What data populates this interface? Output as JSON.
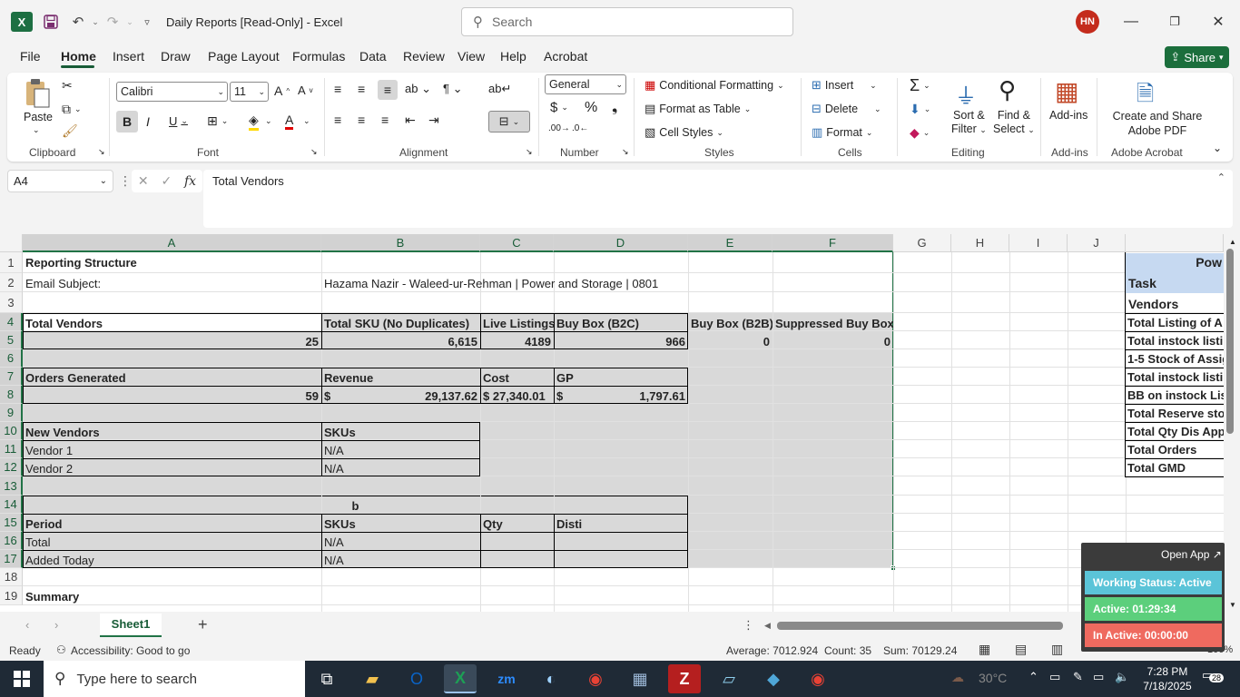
{
  "window": {
    "title": "Daily Reports  [Read-Only]  -  Excel",
    "search_placeholder": "Search",
    "user_initials": "HN"
  },
  "tabs": [
    "File",
    "Home",
    "Insert",
    "Draw",
    "Page Layout",
    "Formulas",
    "Data",
    "Review",
    "View",
    "Help",
    "Acrobat"
  ],
  "share_label": "Share",
  "ribbon": {
    "clipboard": {
      "paste": "Paste",
      "label": "Clipboard"
    },
    "font": {
      "name": "Calibri",
      "size": "11",
      "label": "Font"
    },
    "alignment": {
      "label": "Alignment"
    },
    "number": {
      "format": "General",
      "label": "Number"
    },
    "styles": {
      "conditional": "Conditional Formatting",
      "table": "Format as Table",
      "cell": "Cell Styles",
      "label": "Styles"
    },
    "cells": {
      "insert": "Insert",
      "delete": "Delete",
      "format": "Format",
      "label": "Cells"
    },
    "editing": {
      "sort": "Sort &",
      "filter": "Filter",
      "find": "Find &",
      "select": "Select",
      "label": "Editing"
    },
    "addins": {
      "addins": "Add-ins",
      "label": "Add-ins"
    },
    "acrobat": {
      "line1": "Create and Share",
      "line2": "Adobe PDF",
      "label": "Adobe Acrobat"
    }
  },
  "formula_bar": {
    "name_box": "A4",
    "content": "Total Vendors"
  },
  "columns": [
    "A",
    "B",
    "C",
    "D",
    "E",
    "F",
    "G",
    "H",
    "I",
    "J"
  ],
  "rows": [
    "1",
    "2",
    "3",
    "4",
    "5",
    "6",
    "7",
    "8",
    "9",
    "10",
    "11",
    "12",
    "13",
    "14",
    "15",
    "16",
    "17",
    "18",
    "19"
  ],
  "cells": {
    "A1": "Reporting Structure",
    "A2": "Email Subject:",
    "B2": "Hazama Nazir - Waleed-ur-Rehman | Power and Storage | 0801",
    "A4": "Total Vendors",
    "B4": "Total SKU (No Duplicates)",
    "C4": "Live Listings",
    "D4": "Buy Box (B2C)",
    "E4": "Buy Box (B2B)",
    "F4": "Suppressed Buy Box",
    "A5": "25",
    "B5": "6,615",
    "C5": "4189",
    "D5": "966",
    "E5": "0",
    "F5": "0",
    "A7": "Orders Generated",
    "B7": "Revenue",
    "C7": "Cost",
    "D7": "GP",
    "A8": "59",
    "B8_sym": "$",
    "B8": "29,137.62",
    "C8": "$ 27,340.01",
    "D8_sym": "$",
    "D8": "1,797.61",
    "A10": "New Vendors",
    "B10": "SKUs",
    "A11": "Vendor 1",
    "B11": "N/A",
    "A12": "Vendor 2",
    "B12": "N/A",
    "B14": "b",
    "A15": "Period",
    "B15": "SKUs",
    "C15": "Qty",
    "D15": "Disti",
    "A16": "Total",
    "B16": "N/A",
    "A17": "Added Today",
    "B17": "N/A",
    "A19": "Summary"
  },
  "side_table": {
    "header": "Pow",
    "task": "Task",
    "vendors": "Vendors",
    "items": [
      "Total Listing of A",
      "Total instock listi",
      "1-5 Stock of Assig",
      "Total instock listi",
      "BB on instock List",
      "Total Reserve sto",
      "Total Qty Dis App",
      "Total Orders",
      "Total GMD"
    ]
  },
  "sheet_tab": "Sheet1",
  "status": {
    "ready": "Ready",
    "accessibility": "Accessibility: Good to go",
    "average": "Average: 7012.924",
    "count": "Count: 35",
    "sum": "Sum: 70129.24",
    "zoom": "100%"
  },
  "widget": {
    "open_app": "Open App",
    "working": "Working Status: Active",
    "active": "Active: 01:29:34",
    "inactive": "In Active: 00:00:00"
  },
  "taskbar": {
    "search": "Type here to search",
    "weather": "30°C",
    "time": "7:28 PM",
    "date": "7/18/2025",
    "notifications": "28"
  }
}
